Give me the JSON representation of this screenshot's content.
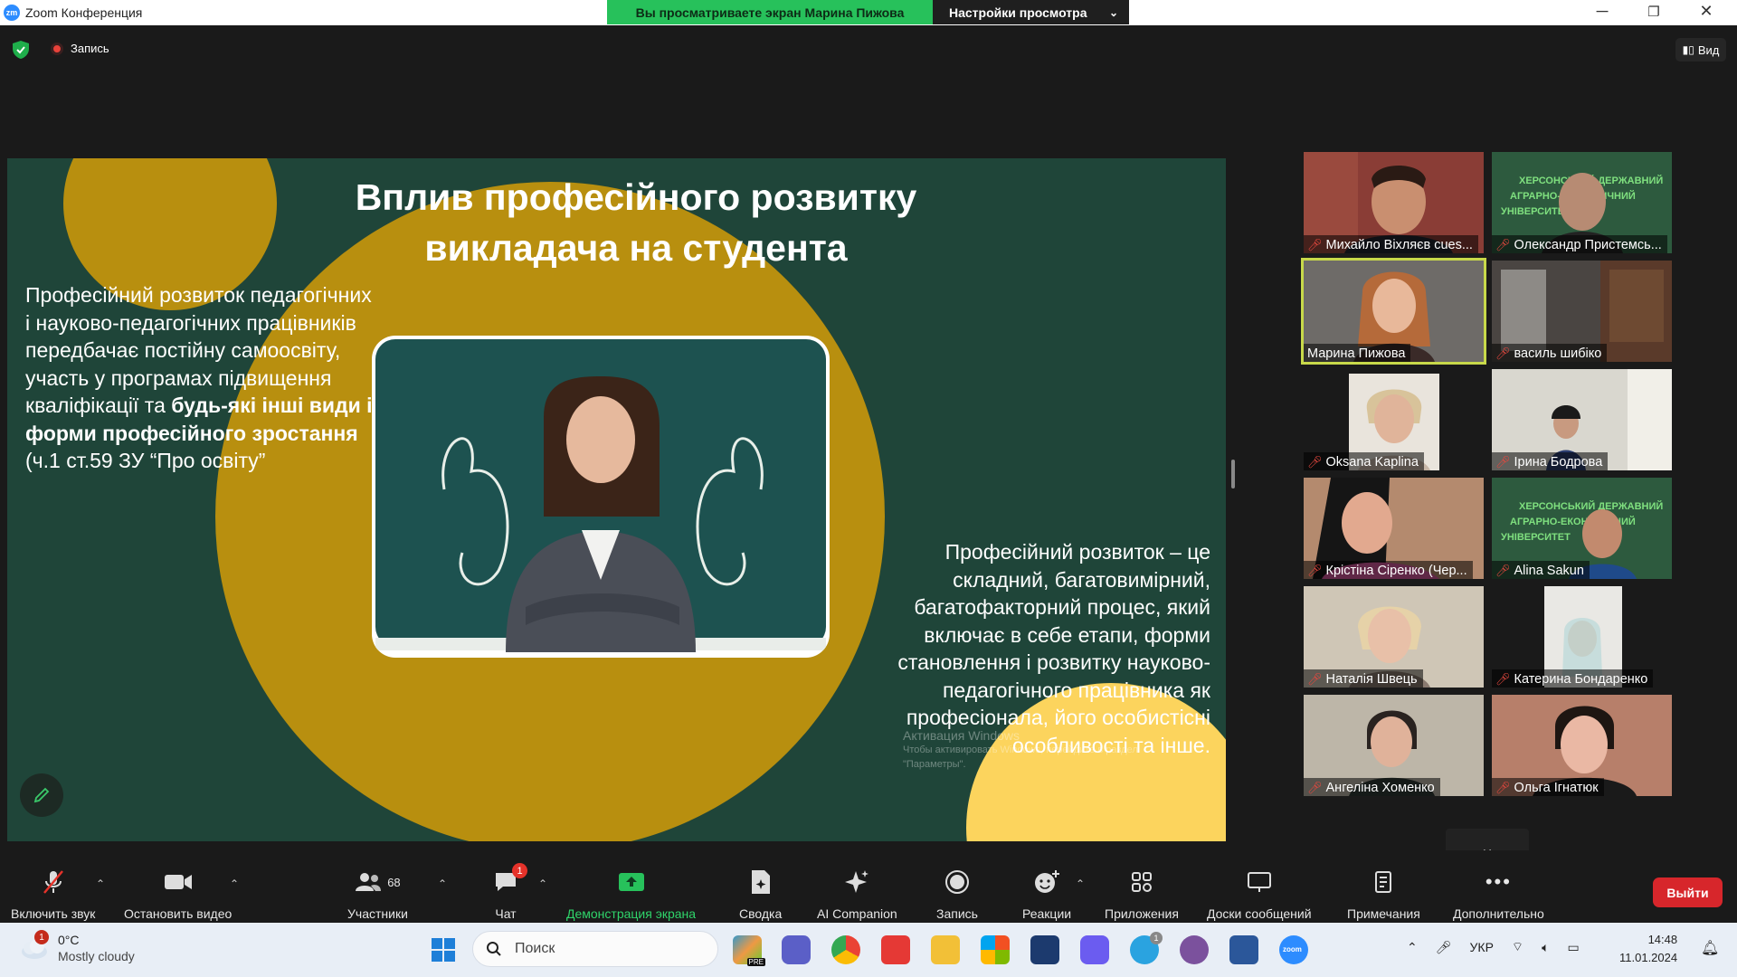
{
  "window": {
    "title": "Zoom Конференция",
    "share_banner": "Вы просматриваете экран Марина Пижова",
    "view_settings": "Настройки просмотра"
  },
  "meeting": {
    "recording_label": "Запись",
    "view_label": "Вид"
  },
  "slide": {
    "title_line1": "Вплив професійного розвитку",
    "title_line2": "викладача на студента",
    "left_text_pre": "Професійний розвиток педагогічних і науково-педагогічних працівників передбачає постійну самоосвіту, участь у програмах підвищення кваліфікації та ",
    "left_text_bold": "будь-які інші види і форми професійного зростання",
    "left_text_post": " (ч.1 ст.59 ЗУ “Про освіту”",
    "right_text": "Професійний розвиток – це складний, багатовимірний, багатофакторний процес, який включає в себе етапи, форми становлення і розвитку науково-педагогічного працівника як професіонала, його особистісні особливості та інше.",
    "watermark_title": "Активация Windows",
    "watermark_sub": "Чтобы активировать Windows, перейдите в раздел \"Параметры\"."
  },
  "participants": [
    {
      "name": "Михайло Віхляєв cues...",
      "muted": true,
      "active": false
    },
    {
      "name": "Олександр Пристемсь...",
      "muted": true,
      "active": false
    },
    {
      "name": "Марина Пижова",
      "muted": false,
      "active": true
    },
    {
      "name": "василь шибіко",
      "muted": true,
      "active": false
    },
    {
      "name": "Oksana Kaplina",
      "muted": true,
      "active": false
    },
    {
      "name": "Ірина Бодрова",
      "muted": true,
      "active": false
    },
    {
      "name": "Крістіна Сіренко (Чер...",
      "muted": true,
      "active": false
    },
    {
      "name": "Alina Sakun",
      "muted": true,
      "active": false
    },
    {
      "name": "Наталія Швець",
      "muted": true,
      "active": false
    },
    {
      "name": "Катерина Бондаренко",
      "muted": true,
      "active": false
    },
    {
      "name": "Ангеліна Хоменко",
      "muted": true,
      "active": false
    },
    {
      "name": "Ольга Ігнатюк",
      "muted": true,
      "active": false
    }
  ],
  "tile_texts": {
    "banner_line1": "ХЕРСОНСЬКИЙ ДЕРЖАВНИЙ",
    "banner_line2": "АГРАРНО-ЕКОНОМІЧНИЙ",
    "banner_line3": "УНІВЕРСИТЕТ"
  },
  "toolbar": {
    "audio": "Включить звук",
    "video": "Остановить видео",
    "participants": "Участники",
    "participants_count": "68",
    "chat": "Чат",
    "chat_badge": "1",
    "share": "Демонстрация экрана",
    "summary": "Сводка",
    "ai": "AI Companion",
    "record": "Запись",
    "reactions": "Реакции",
    "apps": "Приложения",
    "whiteboards": "Доски сообщений",
    "notes": "Примечания",
    "more": "Дополнительно",
    "leave": "Выйти"
  },
  "taskbar": {
    "weather_temp": "0°C",
    "weather_desc": "Mostly cloudy",
    "weather_badge": "1",
    "search_placeholder": "Поиск",
    "language": "УКР",
    "time": "14:48",
    "date": "11.01.2024",
    "telegram_badge": "1",
    "pre_label": "PRE",
    "zoom_label": "zoom"
  },
  "colors": {
    "slide_bg": "#1f4539",
    "ochre": "#b88f0f",
    "yellow": "#fcd45d",
    "share_green": "#27c15b",
    "leave_red": "#d7262b",
    "active_speaker": "#c8d94a"
  }
}
